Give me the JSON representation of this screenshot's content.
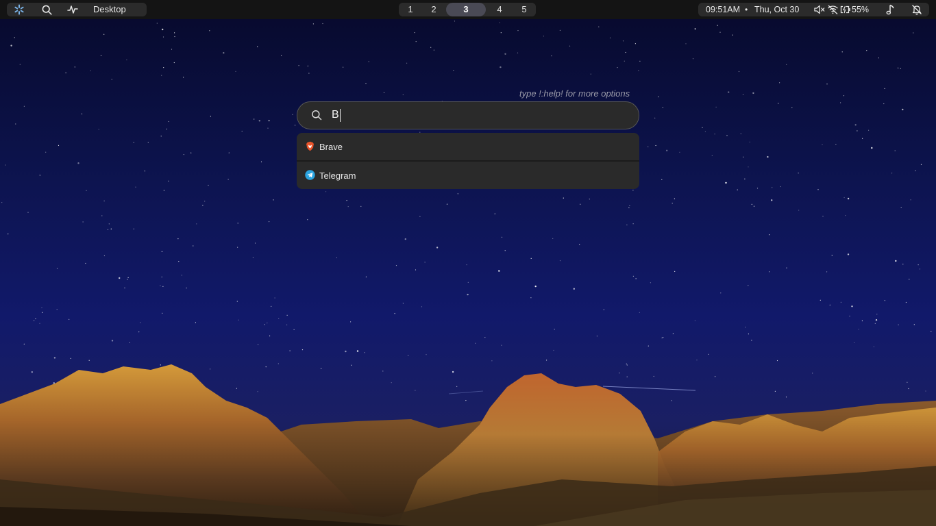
{
  "topbar": {
    "left": {
      "launcher_icon": "nix-snowflake-icon",
      "search_icon": "search-icon",
      "activity_icon": "pulse-icon",
      "desktop_label": "Desktop"
    },
    "workspaces": [
      {
        "label": "1",
        "active": false
      },
      {
        "label": "2",
        "active": false
      },
      {
        "label": "3",
        "active": true
      },
      {
        "label": "4",
        "active": false
      },
      {
        "label": "5",
        "active": false
      }
    ],
    "right": {
      "time": "09:51AM",
      "separator": "•",
      "date": "Thu, Oct 30",
      "volume_icon": "volume-muted-icon",
      "wifi_icon": "wifi-off-icon",
      "battery_icon": "battery-charging-icon",
      "battery_percent": "55%",
      "music_icon": "music-note-icon",
      "notifications_icon": "bell-off-icon"
    }
  },
  "launcher": {
    "hint": "type !:help! for more options",
    "query": "B",
    "results": [
      {
        "label": "Brave",
        "icon": "brave-icon"
      },
      {
        "label": "Telegram",
        "icon": "telegram-icon"
      }
    ]
  },
  "colors": {
    "bar_bg": "#141414",
    "pill_bg": "#2b2b2b",
    "active_ws": "#4a4a55",
    "panel_bg": "#2a2a2a",
    "brave": "#e8542b",
    "telegram": "#2aa3e0",
    "snowflake": "#7ab3e8"
  }
}
